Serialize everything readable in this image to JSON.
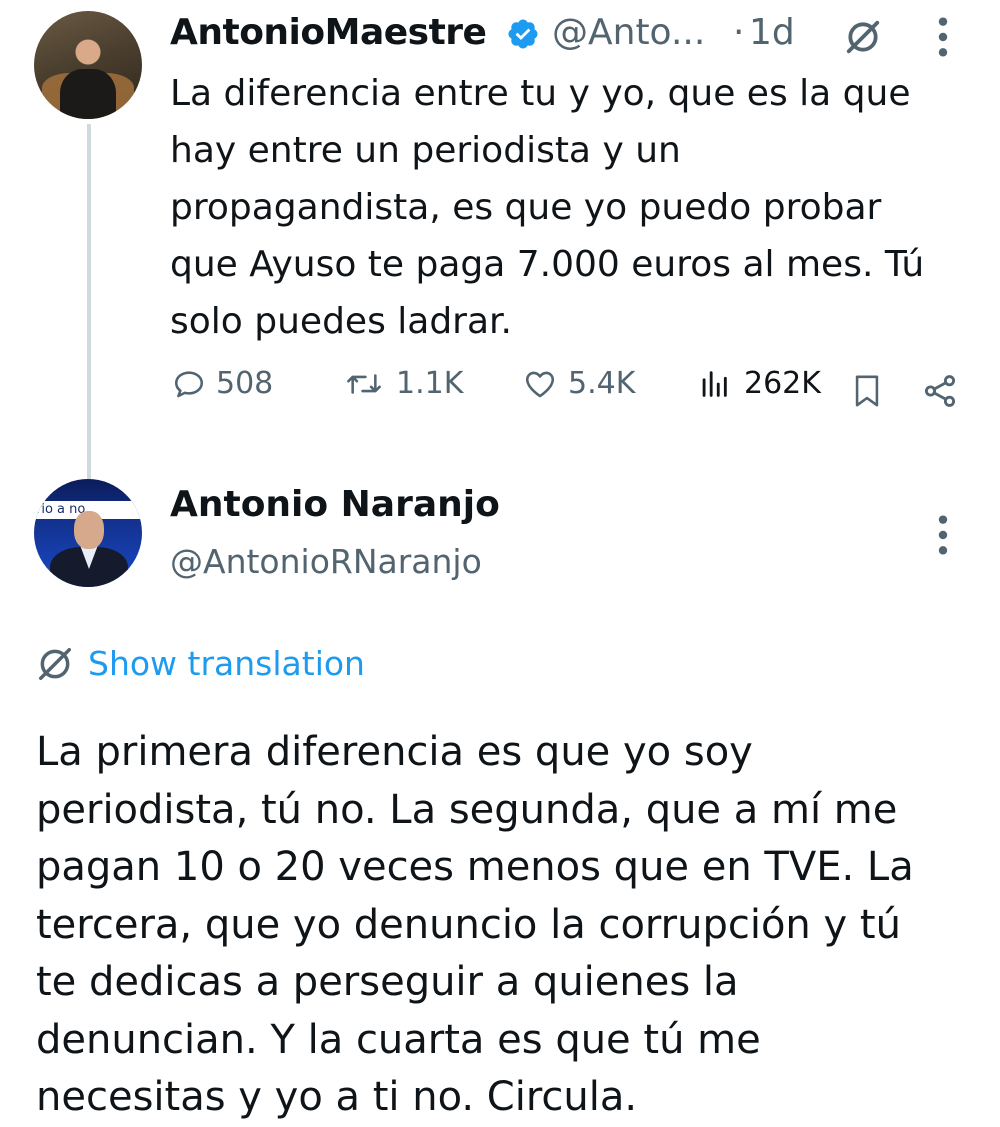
{
  "tweet1": {
    "author_name": "AntonioMaestre",
    "handle": "@Anto...",
    "separator": "·",
    "time": "1d",
    "text": "La diferencia entre tu y yo, que es la que\nhay entre un periodista y un\npropagandista, es que yo puedo probar\nque Ayuso te paga 7.000 euros al mes. Tú\nsolo puedes ladrar.",
    "icons": {
      "verified": "verified-badge-icon",
      "grok": "grok-icon",
      "more": "more-options-icon"
    },
    "stats": {
      "replies": "508",
      "reposts": "1.1K",
      "likes": "5.4K",
      "views": "262K"
    }
  },
  "tweet2": {
    "author_name": "Antonio Naranjo",
    "handle": "@AntonioRNaranjo",
    "avatar_text": "rio  a no",
    "show_translation_label": "Show translation",
    "text": "La primera diferencia es que yo soy\nperiodista, tú no. La segunda, que a mí me\npagan 10 o 20 veces menos que en TVE. La\ntercera, que yo denuncio la corrupción y tú\nte dedicas a perseguir a quienes la\ndenuncian. Y la cuarta es que tú me\nnecesitas y yo a ti no. Circula."
  },
  "colors": {
    "text": "#0f1419",
    "secondary": "#536471",
    "accent": "#1d9bf0",
    "thread_line": "#cfd9de"
  }
}
